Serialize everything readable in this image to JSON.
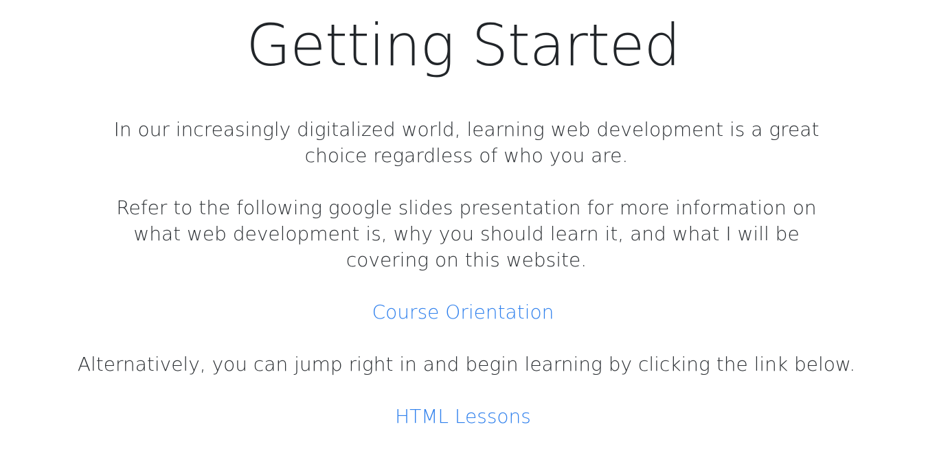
{
  "page": {
    "title": "Getting Started",
    "intro": "In our increasingly digitalized world, learning web development is a great choice regardless of who you are.",
    "refer": "Refer to the following google slides presentation for more information on what web development is, why you should learn it, and what I will be covering on this website.",
    "orientation_link": "Course Orientation",
    "alternative": "Alternatively, you can jump right in and begin learning by clicking the link below.",
    "lessons_link": "HTML Lessons"
  },
  "colors": {
    "text": "#212529",
    "link": "#2f80ed",
    "background": "#ffffff"
  }
}
